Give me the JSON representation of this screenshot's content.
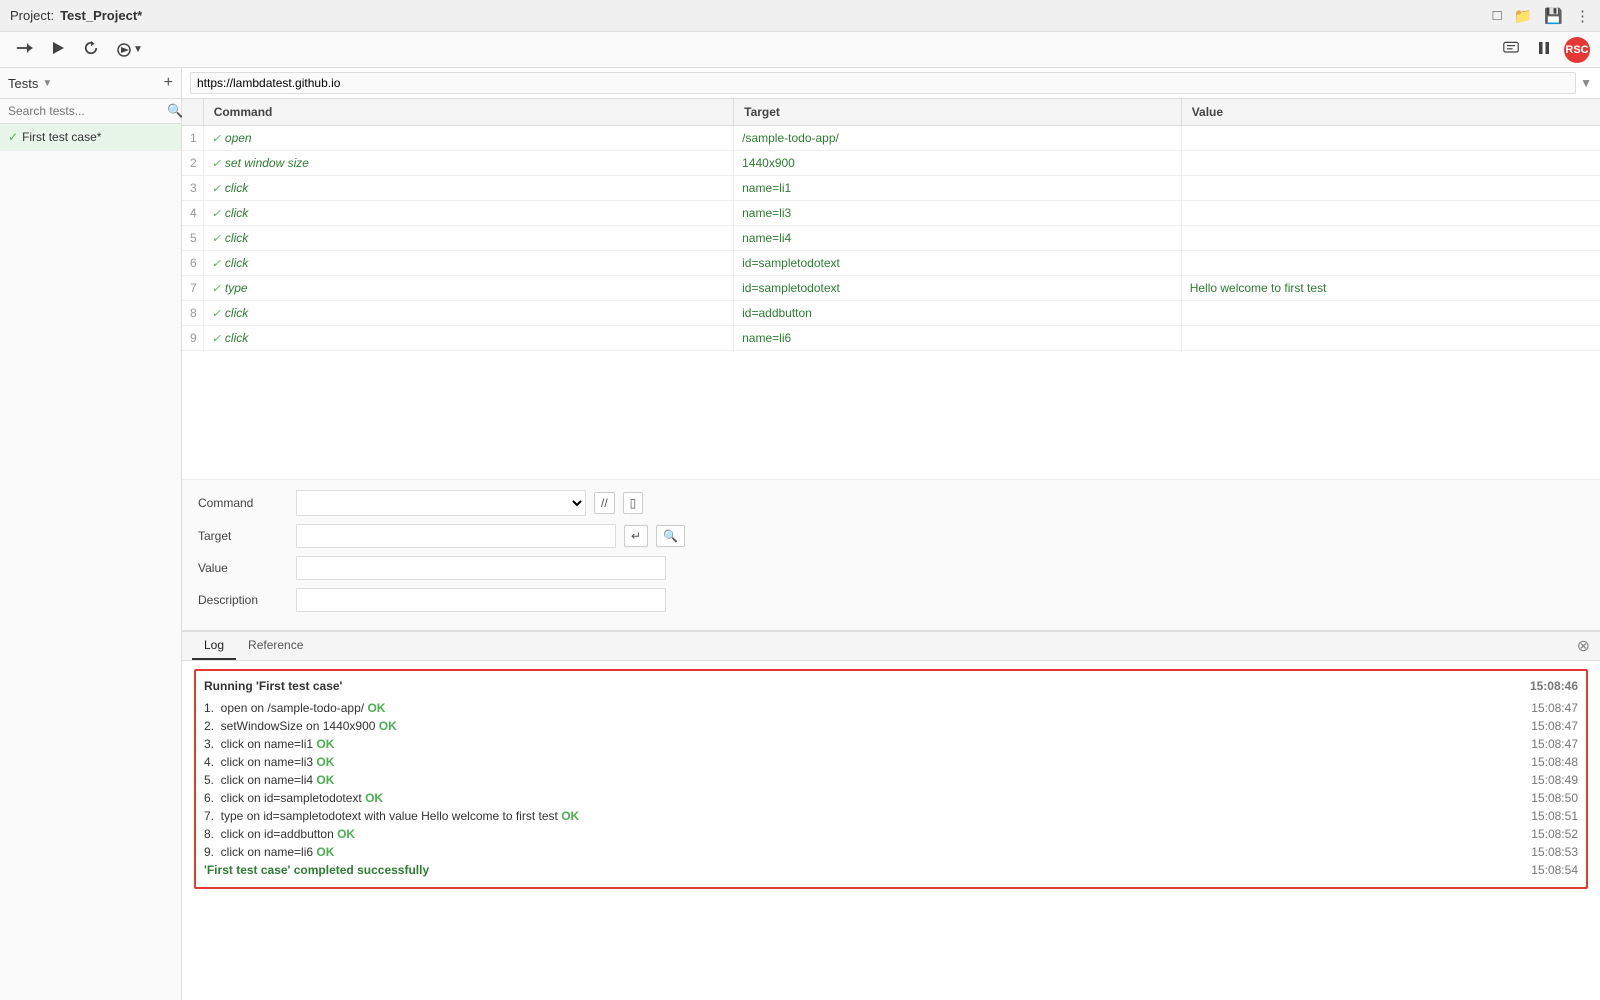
{
  "titleBar": {
    "projectLabel": "Project:",
    "projectName": "Test_Project*",
    "icons": [
      "new-file",
      "open-folder",
      "save",
      "more-options"
    ]
  },
  "toolbar": {
    "buttons": [
      "step-over",
      "run",
      "reset",
      "run-with-options"
    ],
    "rightButtons": [
      "comment",
      "pause",
      "avatar"
    ]
  },
  "sidebar": {
    "title": "Tests",
    "addLabel": "+",
    "search": {
      "placeholder": "Search tests...",
      "value": ""
    },
    "items": [
      {
        "label": "First test case*",
        "status": "active",
        "checked": true
      }
    ]
  },
  "urlBar": {
    "value": "https://lambdatest.github.io",
    "placeholder": "https://lambdatest.github.io"
  },
  "table": {
    "columns": [
      "Command",
      "Target",
      "Value"
    ],
    "rows": [
      {
        "num": 1,
        "command": "open",
        "target": "/sample-todo-app/",
        "value": ""
      },
      {
        "num": 2,
        "command": "set window size",
        "target": "1440x900",
        "value": ""
      },
      {
        "num": 3,
        "command": "click",
        "target": "name=li1",
        "value": ""
      },
      {
        "num": 4,
        "command": "click",
        "target": "name=li3",
        "value": ""
      },
      {
        "num": 5,
        "command": "click",
        "target": "name=li4",
        "value": ""
      },
      {
        "num": 6,
        "command": "click",
        "target": "id=sampletodotext",
        "value": ""
      },
      {
        "num": 7,
        "command": "type",
        "target": "id=sampletodotext",
        "value": "Hello welcome to first test"
      },
      {
        "num": 8,
        "command": "click",
        "target": "id=addbutton",
        "value": ""
      },
      {
        "num": 9,
        "command": "click",
        "target": "name=li6",
        "value": ""
      }
    ]
  },
  "commandForm": {
    "commandLabel": "Command",
    "targetLabel": "Target",
    "valueLabel": "Value",
    "descriptionLabel": "Description",
    "commandPlaceholder": "",
    "targetPlaceholder": "",
    "valuePlaceholder": "",
    "descriptionPlaceholder": ""
  },
  "bottomPanel": {
    "tabs": [
      "Log",
      "Reference"
    ],
    "activeTab": "Log",
    "logHeader": "Running 'First test case'",
    "logHeaderTime": "15:08:46",
    "logLines": [
      {
        "num": 1,
        "text": "open on /sample-todo-app/",
        "status": "OK",
        "time": "15:08:47"
      },
      {
        "num": 2,
        "text": "setWindowSize on 1440x900",
        "status": "OK",
        "time": "15:08:47"
      },
      {
        "num": 3,
        "text": "click on name=li1",
        "status": "OK",
        "time": "15:08:47"
      },
      {
        "num": 4,
        "text": "click on name=li3",
        "status": "OK",
        "time": "15:08:48"
      },
      {
        "num": 5,
        "text": "click on name=li4",
        "status": "OK",
        "time": "15:08:49"
      },
      {
        "num": 6,
        "text": "click on id=sampletodotext",
        "status": "OK",
        "time": "15:08:50"
      },
      {
        "num": 7,
        "text": "type on id=sampletodotext with value Hello welcome to first test",
        "status": "OK",
        "time": "15:08:51"
      },
      {
        "num": 8,
        "text": "click on id=addbutton",
        "status": "OK",
        "time": "15:08:52"
      },
      {
        "num": 9,
        "text": "click on name=li6",
        "status": "OK",
        "time": "15:08:53"
      }
    ],
    "successMessage": "'First test case' completed successfully",
    "successTime": "15:08:54"
  },
  "avatar": {
    "initials": "RSC"
  }
}
